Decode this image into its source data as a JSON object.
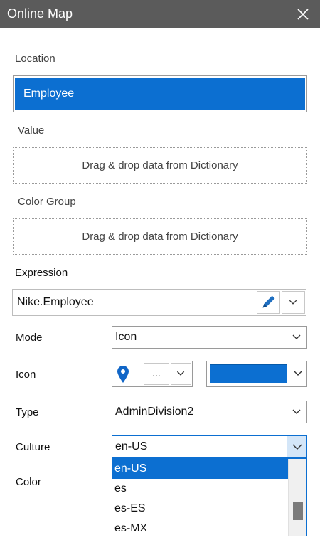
{
  "dialog": {
    "title": "Online Map"
  },
  "location": {
    "label": "Location",
    "value": "Employee"
  },
  "value": {
    "label": "Value",
    "placeholder": "Drag & drop data from Dictionary"
  },
  "color_group": {
    "label": "Color Group",
    "placeholder": "Drag & drop data from Dictionary"
  },
  "expression": {
    "label": "Expression",
    "value": "Nike.Employee"
  },
  "mode": {
    "label": "Mode",
    "value": "Icon"
  },
  "icon": {
    "label": "Icon",
    "more_label": "...",
    "color": "#0c6fd1"
  },
  "type": {
    "label": "Type",
    "value": "AdminDivision2"
  },
  "culture": {
    "label": "Culture",
    "value": "en-US",
    "options": [
      "en-US",
      "es",
      "es-ES",
      "es-MX"
    ]
  },
  "color": {
    "label": "Color"
  },
  "theme": {
    "accent": "#0c6fd1",
    "titlebar": "#5b5b5b"
  }
}
